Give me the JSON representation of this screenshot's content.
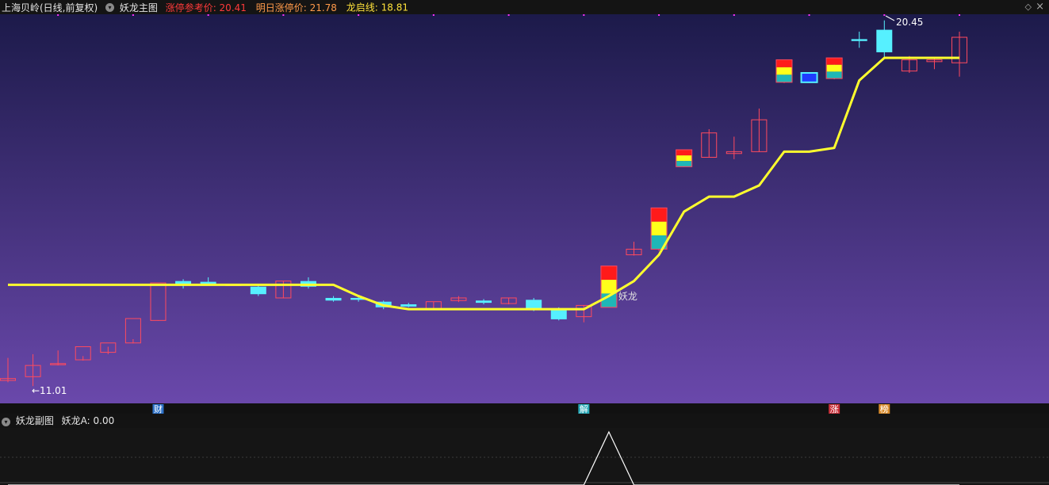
{
  "header": {
    "stock": "上海贝岭(日线,前复权)",
    "main_chart": "妖龙主图",
    "ref_price_label": "涨停参考价: 20.41",
    "next_limit_label": "明日涨停价: 21.78",
    "dragon_line_label": "龙启线: 18.81"
  },
  "colors": {
    "up": "#ff4a5e",
    "down": "#56f0ff",
    "line": "#ffff2e",
    "blue_bar": "#1f3cff",
    "bg_top": "#1c1a4a",
    "bg_bottom": "#6a48ab"
  },
  "chart_data": [
    {
      "type": "candlestick",
      "series": [
        {
          "o": 10.85,
          "h": 11.45,
          "l": 10.8,
          "c": 10.9
        },
        {
          "o": 10.95,
          "h": 11.55,
          "l": 10.7,
          "c": 11.25
        },
        {
          "o": 11.3,
          "h": 11.65,
          "l": 11.25,
          "c": 11.3
        },
        {
          "o": 11.4,
          "h": 11.5,
          "l": 11.38,
          "c": 11.75
        },
        {
          "o": 11.6,
          "h": 11.75,
          "l": 11.55,
          "c": 11.85
        },
        {
          "o": 11.85,
          "h": 11.95,
          "l": 11.84,
          "c": 12.5
        },
        {
          "o": 12.45,
          "h": 12.45,
          "l": 12.44,
          "c": 13.45
        },
        {
          "o": 13.5,
          "h": 13.55,
          "l": 13.3,
          "c": 13.38
        },
        {
          "o": 13.48,
          "h": 13.6,
          "l": 13.38,
          "c": 13.4
        },
        {
          "o": 13.4,
          "h": 13.42,
          "l": 13.38,
          "c": 13.41
        },
        {
          "o": 13.35,
          "h": 13.4,
          "l": 13.1,
          "c": 13.15
        },
        {
          "o": 13.05,
          "h": 13.5,
          "l": 13.04,
          "c": 13.5
        },
        {
          "o": 13.5,
          "h": 13.6,
          "l": 13.3,
          "c": 13.35
        },
        {
          "o": 13.05,
          "h": 13.1,
          "l": 12.95,
          "c": 12.98
        },
        {
          "o": 13.05,
          "h": 13.1,
          "l": 12.95,
          "c": 13.0
        },
        {
          "o": 12.95,
          "h": 12.98,
          "l": 12.75,
          "c": 12.8
        },
        {
          "o": 12.88,
          "h": 12.92,
          "l": 12.8,
          "c": 12.82
        },
        {
          "o": 12.75,
          "h": 12.95,
          "l": 12.74,
          "c": 12.95
        },
        {
          "o": 12.98,
          "h": 13.1,
          "l": 12.94,
          "c": 13.05
        },
        {
          "o": 12.98,
          "h": 13.02,
          "l": 12.88,
          "c": 12.92
        },
        {
          "o": 12.9,
          "h": 13.05,
          "l": 12.88,
          "c": 13.05
        },
        {
          "o": 13.0,
          "h": 13.05,
          "l": 12.7,
          "c": 12.75
        },
        {
          "o": 12.75,
          "h": 12.8,
          "l": 12.45,
          "c": 12.48
        },
        {
          "o": 12.55,
          "h": 12.85,
          "l": 12.4,
          "c": 12.85
        },
        {
          "o": 12.8,
          "h": 13.9,
          "l": 12.8,
          "c": 13.9,
          "bar": true
        },
        {
          "o": 14.2,
          "h": 14.55,
          "l": 14.18,
          "c": 14.35
        },
        {
          "o": 14.35,
          "h": 15.45,
          "l": 14.3,
          "c": 15.45,
          "bar": true
        },
        {
          "o": 16.55,
          "h": 17.0,
          "l": 16.54,
          "c": 17.0,
          "bar": true
        },
        {
          "o": 16.8,
          "h": 17.55,
          "l": 16.8,
          "c": 17.45
        },
        {
          "o": 16.9,
          "h": 17.35,
          "l": 16.75,
          "c": 16.95
        },
        {
          "o": 16.95,
          "h": 18.1,
          "l": 16.94,
          "c": 17.8
        },
        {
          "o": 18.8,
          "h": 19.4,
          "l": 18.78,
          "c": 19.4,
          "bar": true
        },
        {
          "o": 18.8,
          "h": 19.05,
          "l": 18.78,
          "c": 19.05,
          "blue": true
        },
        {
          "o": 18.9,
          "h": 19.45,
          "l": 18.88,
          "c": 19.45,
          "bar": true
        },
        {
          "o": 19.95,
          "h": 20.15,
          "l": 19.72,
          "c": 19.9
        },
        {
          "o": 20.2,
          "h": 20.45,
          "l": 19.48,
          "c": 19.6
        },
        {
          "o": 19.1,
          "h": 19.5,
          "l": 19.05,
          "c": 19.4
        },
        {
          "o": 19.35,
          "h": 19.45,
          "l": 19.15,
          "c": 19.4
        },
        {
          "o": 19.32,
          "h": 20.15,
          "l": 18.95,
          "c": 20.0
        }
      ],
      "dragon_line": [
        13.4,
        13.4,
        13.4,
        13.4,
        13.4,
        13.4,
        13.4,
        13.4,
        13.4,
        13.4,
        13.4,
        13.4,
        13.4,
        13.4,
        13.1,
        12.85,
        12.75,
        12.75,
        12.75,
        12.75,
        12.75,
        12.75,
        12.75,
        12.75,
        13.1,
        13.5,
        14.2,
        15.35,
        15.75,
        15.75,
        16.05,
        16.95,
        16.95,
        17.05,
        18.85,
        19.45,
        19.45,
        19.45,
        19.45
      ],
      "markers": [
        {
          "index": 24,
          "label": "妖龙"
        }
      ],
      "annotations": {
        "low_label": "←11.01",
        "high_label": "20.45"
      },
      "ylim": [
        10.45,
        20.55
      ]
    },
    {
      "type": "line",
      "title": "妖龙副图",
      "value_label": "妖龙A: 0.00",
      "values": [
        0,
        0,
        0,
        0,
        0,
        0,
        0,
        0,
        0,
        0,
        0,
        0,
        0,
        0,
        0,
        0,
        0,
        0,
        0,
        0,
        0,
        0,
        0,
        0,
        1,
        0,
        0,
        0,
        0,
        0,
        0,
        0,
        0,
        0,
        0,
        0,
        0,
        0,
        0
      ]
    }
  ],
  "event_tags": [
    {
      "label": "财",
      "index": 6,
      "color": "#2e72c8"
    },
    {
      "label": "解",
      "index": 23,
      "color": "#29a9b8"
    },
    {
      "label": "涨",
      "index": 33,
      "color": "#c8303a"
    },
    {
      "label": "榜",
      "index": 35,
      "color": "#d88a2a"
    }
  ]
}
